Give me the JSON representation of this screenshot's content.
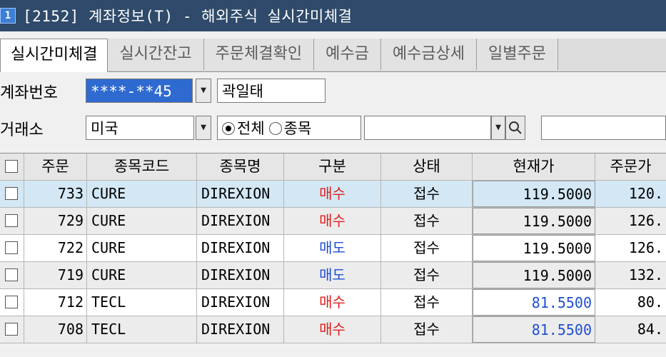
{
  "window": {
    "icon_label": "1",
    "title": "[2152] 계좌정보(T) - 해외주식 실시간미체결"
  },
  "tabs": [
    "실시간미체결",
    "실시간잔고",
    "주문체결확인",
    "예수금",
    "예수금상세",
    "일별주문"
  ],
  "account": {
    "label": "계좌번호",
    "number": "****-**45",
    "owner": "곽일태"
  },
  "exchange": {
    "label": "거래소",
    "value": "미국"
  },
  "filter": {
    "all_label": "전체",
    "item_label": "종목",
    "selected": "전체"
  },
  "columns": [
    "주문",
    "종목코드",
    "종목명",
    "구분",
    "상태",
    "현재가",
    "주문가"
  ],
  "orders": [
    {
      "no": "733",
      "code": "CURE",
      "name": "DIREXION",
      "side": "매수",
      "side_type": "buy",
      "status": "접수",
      "price": "119.5000",
      "order_price": "120.",
      "price_blue": false
    },
    {
      "no": "729",
      "code": "CURE",
      "name": "DIREXION",
      "side": "매수",
      "side_type": "buy",
      "status": "접수",
      "price": "119.5000",
      "order_price": "126.",
      "price_blue": false
    },
    {
      "no": "722",
      "code": "CURE",
      "name": "DIREXION",
      "side": "매도",
      "side_type": "sell",
      "status": "접수",
      "price": "119.5000",
      "order_price": "126.",
      "price_blue": false
    },
    {
      "no": "719",
      "code": "CURE",
      "name": "DIREXION",
      "side": "매도",
      "side_type": "sell",
      "status": "접수",
      "price": "119.5000",
      "order_price": "132.",
      "price_blue": false
    },
    {
      "no": "712",
      "code": "TECL",
      "name": "DIREXION",
      "side": "매수",
      "side_type": "buy",
      "status": "접수",
      "price": "81.5500",
      "order_price": "80.",
      "price_blue": true
    },
    {
      "no": "708",
      "code": "TECL",
      "name": "DIREXION",
      "side": "매수",
      "side_type": "buy",
      "status": "접수",
      "price": "81.5500",
      "order_price": "84.",
      "price_blue": true
    }
  ],
  "colors": {
    "title_bg": "#2f4a6a",
    "selected_bg": "#2f6ad0",
    "buy": "#e02020",
    "sell": "#1f4fd0",
    "highlight_row": "#d3e8f4"
  }
}
